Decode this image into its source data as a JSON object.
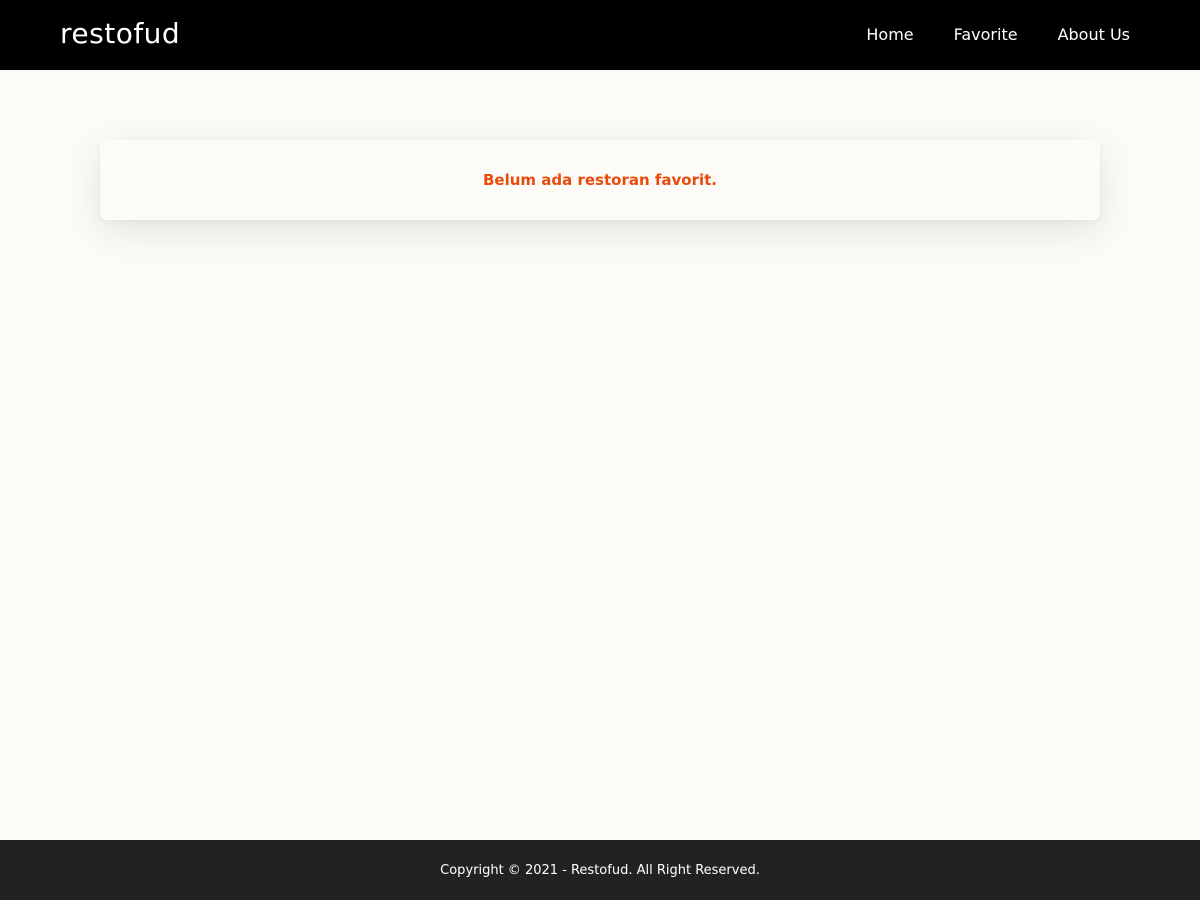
{
  "header": {
    "brand": "restofud",
    "nav": {
      "home": "Home",
      "favorite": "Favorite",
      "about": "About Us"
    }
  },
  "main": {
    "empty_message": "Belum ada restoran favorit."
  },
  "footer": {
    "copyright": "Copyright © 2021 - Restofud. All Right Reserved."
  },
  "colors": {
    "navbar_bg": "#000000",
    "page_bg": "#fcfbf7",
    "accent": "#ea4b0c",
    "footer_bg": "#222222"
  }
}
